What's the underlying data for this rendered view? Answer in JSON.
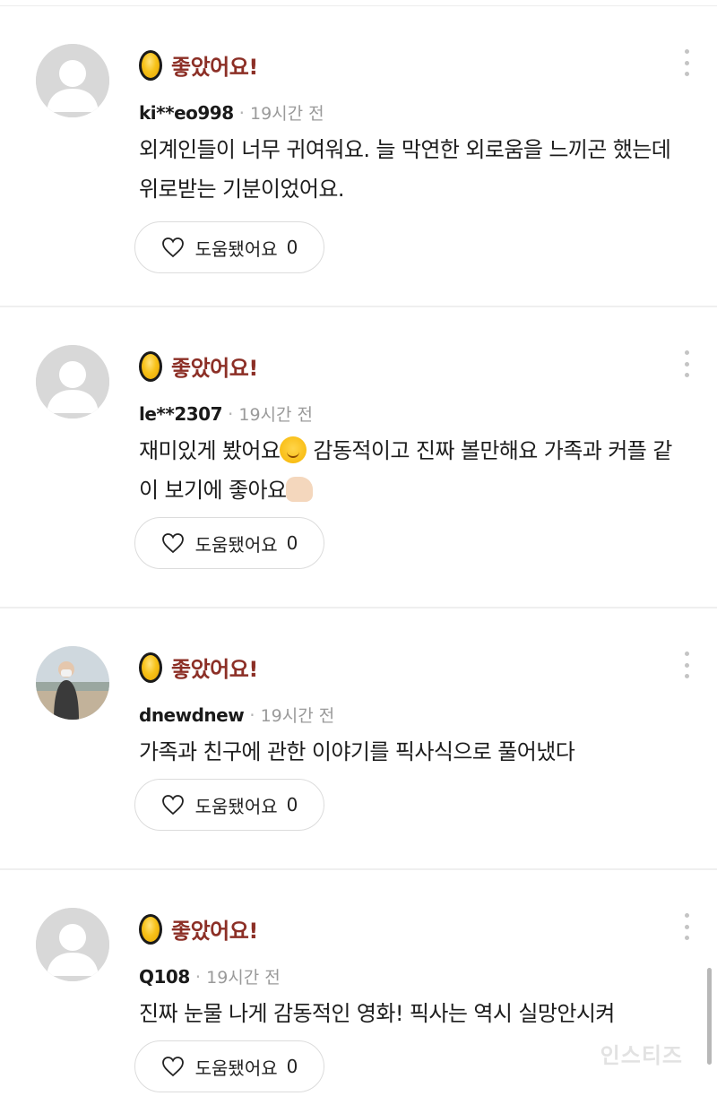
{
  "comments": [
    {
      "rating_label": "좋았어요!",
      "username": "ki**eo998",
      "time": "19시간 전",
      "body": "외계인들이 너무 귀여워요. 늘 막연한 외로움을 느끼곤 했는데 위로받는 기분이었어요.",
      "helpful_label": "도움됐어요",
      "helpful_count": "0",
      "avatar": "default-avatar"
    },
    {
      "rating_label": "좋았어요!",
      "username": "le**2307",
      "time": "19시간 전",
      "body_part1": "재미있게 봤어요",
      "body_part2": " 감동적이고 진짜 볼만해요 가족과 커플 같이 보기에 좋아요",
      "emoji1": "smiling-face-with-hearts",
      "emoji2": "thumbs-up",
      "helpful_label": "도움됐어요",
      "helpful_count": "0",
      "avatar": "default-avatar"
    },
    {
      "rating_label": "좋았어요!",
      "username": "dnewdnew",
      "time": "19시간 전",
      "body": "가족과 친구에 관한 이야기를 픽사식으로 풀어냈다",
      "helpful_label": "도움됐어요",
      "helpful_count": "0",
      "avatar": "photo-avatar"
    },
    {
      "rating_label": "좋았어요!",
      "username": "Q108",
      "time": "19시간 전",
      "body": "진짜 눈물 나게 감동적인 영화! 픽사는 역시 실망안시켜",
      "helpful_label": "도움됐어요",
      "helpful_count": "0",
      "avatar": "default-avatar"
    }
  ],
  "watermark": "인스티즈",
  "colors": {
    "rating_text": "#8c2f26",
    "egg": "#f7c21a",
    "divider": "#efefef"
  }
}
